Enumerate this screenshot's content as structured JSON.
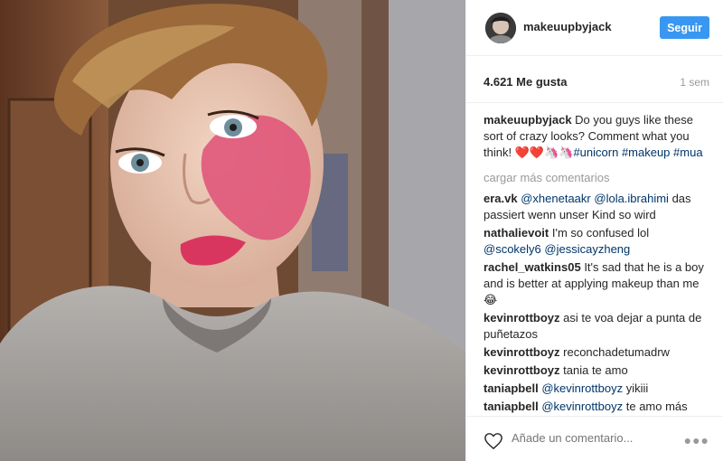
{
  "post": {
    "username": "makeuupbyjack",
    "follow_label": "Seguir",
    "likes": "4.621 Me gusta",
    "time_ago": "1 sem"
  },
  "caption": {
    "username": "makeuupbyjack",
    "text": "Do you guys like these sort of crazy looks? Comment what you think! ",
    "emojis": "❤️❤️🦄🦄",
    "hashtags": [
      "#unicorn",
      "#makeup",
      "#mua"
    ]
  },
  "load_more_label": "cargar más comentarios",
  "comments": [
    {
      "username": "era.vk",
      "mentions": [
        "@xhenetaakr",
        "@lola.ibrahimi"
      ],
      "text": "das passiert wenn unser Kind so wird"
    },
    {
      "username": "nathalievoit",
      "text": "I'm so confused lol",
      "mentions_after": [
        "@scokely6",
        "@jessicayzheng"
      ]
    },
    {
      "username": "rachel_watkins05",
      "text": "It's sad that he is a boy and is better at applying makeup than me😂"
    },
    {
      "username": "kevinrottboyz",
      "text": "asi te voa dejar a punta de puñetazos"
    },
    {
      "username": "kevinrottboyz",
      "text": "reconchadetumadrw"
    },
    {
      "username": "kevinrottboyz",
      "text": "tania te amo"
    },
    {
      "username": "taniapbell",
      "mentions": [
        "@kevinrottboyz"
      ],
      "text": "yikiii"
    },
    {
      "username": "taniapbell",
      "mentions": [
        "@kevinrottboyz"
      ],
      "text": "te amo más"
    }
  ],
  "add_comment": {
    "placeholder": "Añade un comentario..."
  },
  "icons": {
    "like": "heart-icon",
    "options": "more-options-icon"
  },
  "colors": {
    "follow_button": "#3897f0",
    "link": "#003569",
    "muted": "#999999"
  }
}
